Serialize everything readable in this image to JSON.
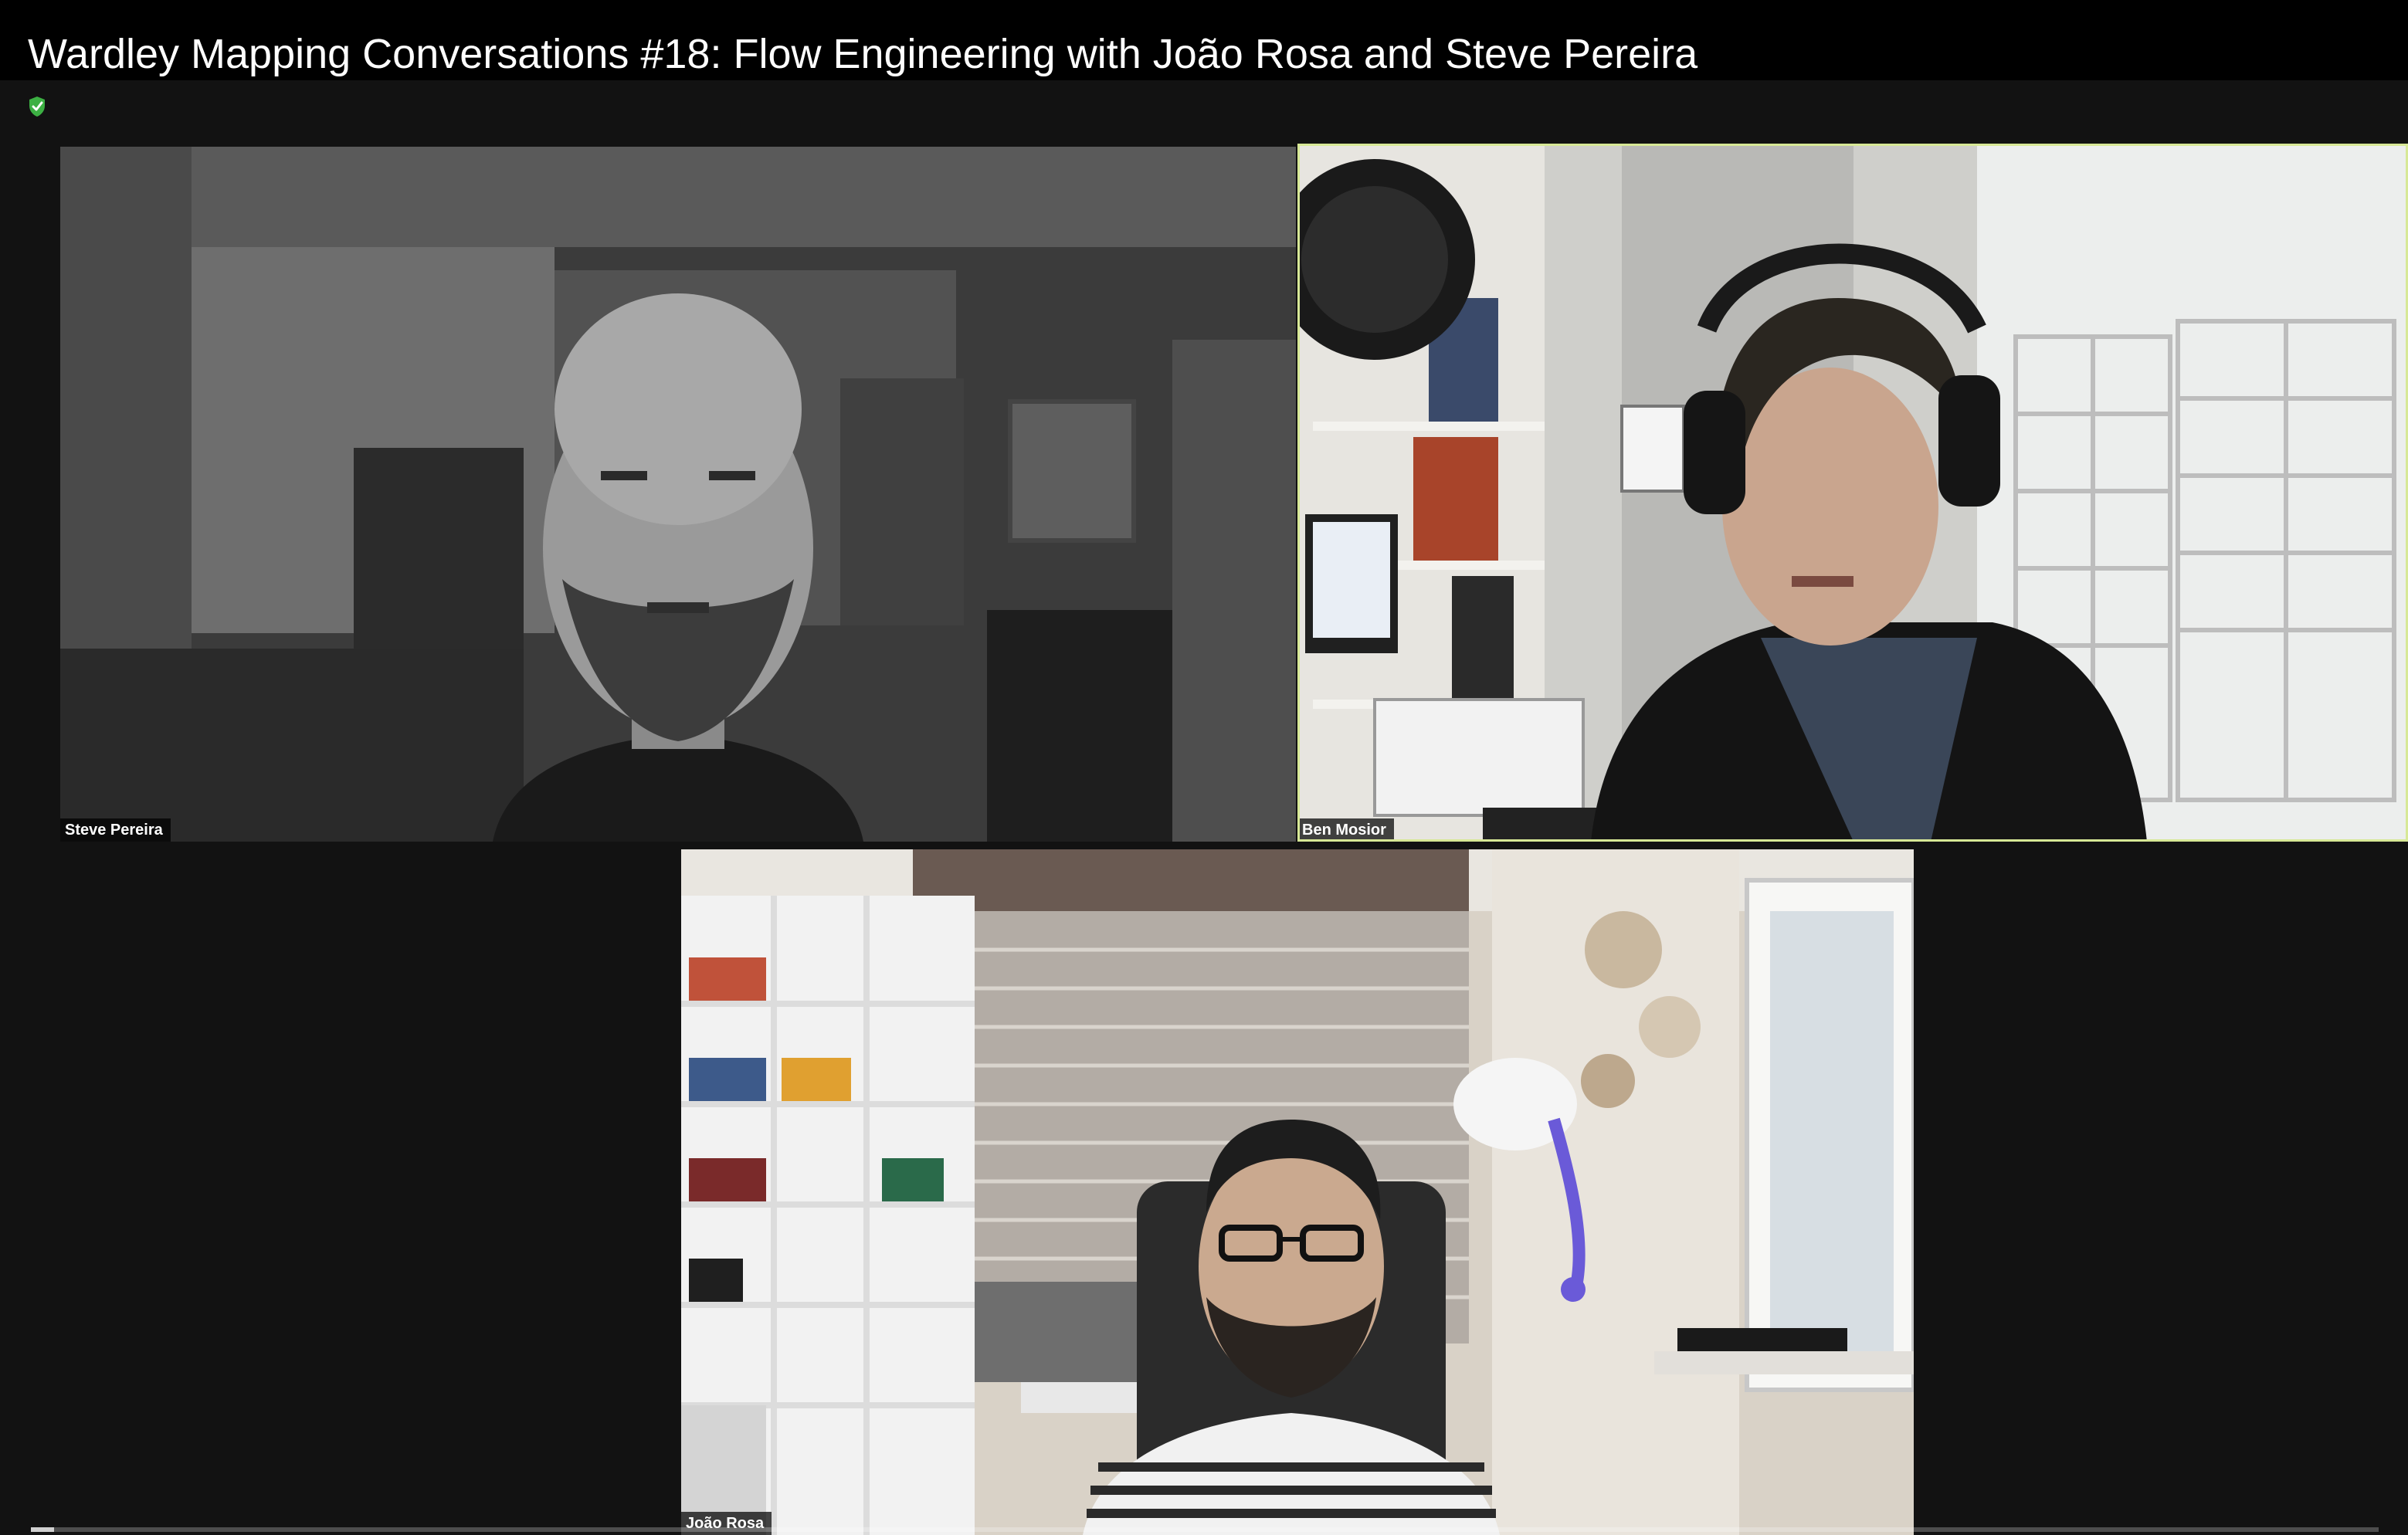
{
  "window": {
    "title": "Wardley Mapping Conversations #18: Flow Engineering with João Rosa and Steve Pereira"
  },
  "participants": [
    {
      "name": "Steve Pereira",
      "active_speaker": false
    },
    {
      "name": "Ben Mosior",
      "active_speaker": true
    },
    {
      "name": "João Rosa",
      "active_speaker": false
    }
  ],
  "colors": {
    "active_speaker_border": "#d7e896",
    "encryption_shield": "#3cb043",
    "background": "#121212"
  },
  "icons": {
    "encryption": "shield-check-icon"
  },
  "playback": {
    "progress_fraction": 0.01
  }
}
